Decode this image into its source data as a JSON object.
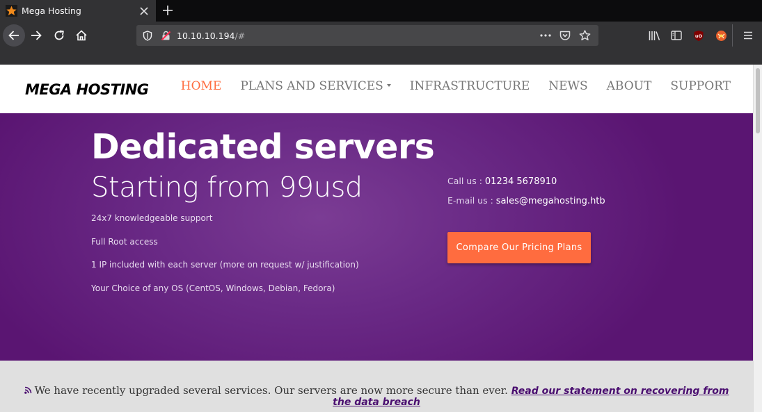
{
  "browser": {
    "tab_title": "Mega Hosting",
    "url_host": "10.10.10.194",
    "url_hash": "/#"
  },
  "site": {
    "logo": "MEGA HOSTING",
    "nav": [
      {
        "label": "HOME",
        "active": true
      },
      {
        "label": "PLANS AND SERVICES",
        "active": false
      },
      {
        "label": "INFRASTRUCTURE",
        "active": false
      },
      {
        "label": "NEWS",
        "active": false
      },
      {
        "label": "ABOUT",
        "active": false
      },
      {
        "label": "SUPPORT",
        "active": false
      }
    ]
  },
  "hero": {
    "title": "Dedicated servers",
    "subtitle": "Starting from 99usd",
    "features": [
      "24x7 knowledgeable support",
      "Full Root access",
      "1 IP included with each server (more on request w/ justification)",
      "Your Choice of any OS (CentOS, Windows, Debian, Fedora)"
    ],
    "call_label": "Call us : ",
    "call_value": "01234 5678910",
    "email_label": "E-mail us : ",
    "email_value": "sales@megahosting.htb",
    "cta_label": "Compare Our Pricing Plans"
  },
  "notice": {
    "text": "We have recently upgraded several services. Our servers are now more secure than ever. ",
    "link": "Read our statement on recovering from the data breach"
  },
  "colors": {
    "accent": "#ff6c3f",
    "hero_purple": "#6a2a86",
    "chrome_dark": "#323234"
  }
}
